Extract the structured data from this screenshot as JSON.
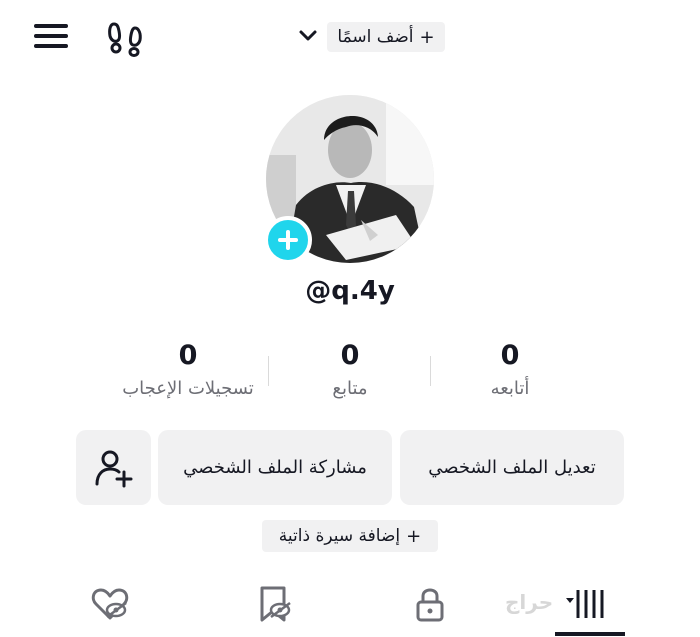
{
  "header": {
    "add_name_label": "أضف اسمًا",
    "add_name_plus": "+",
    "icons": {
      "menu": "hamburger-menu-icon",
      "footprints": "footprints-icon",
      "chevron": "chevron-down-icon"
    }
  },
  "profile": {
    "username": "@q.4y",
    "avatar_icon": "profile-photo",
    "add_avatar_icon": "plus-icon"
  },
  "stats": [
    {
      "value": "0",
      "label": "أتابعه"
    },
    {
      "value": "0",
      "label": "متابع"
    },
    {
      "value": "0",
      "label": "تسجيلات الإعجاب"
    }
  ],
  "actions": {
    "edit_profile": "تعديل الملف الشخصي",
    "share_profile": "مشاركة الملف الشخصي",
    "add_friend_icon": "add-user-icon"
  },
  "bio": {
    "label": "إضافة سيرة ذاتية",
    "plus": "+"
  },
  "tabs": [
    {
      "icon": "videos-grid-icon",
      "active": true
    },
    {
      "icon": "lock-icon",
      "active": false
    },
    {
      "icon": "bookmark-hidden-icon",
      "active": false
    },
    {
      "icon": "heart-hidden-icon",
      "active": false
    }
  ],
  "watermark": "حراج",
  "colors": {
    "accent": "#20d5ec",
    "chip_bg": "#f1f1f2",
    "text": "#161823",
    "muted": "#6d6e75"
  }
}
